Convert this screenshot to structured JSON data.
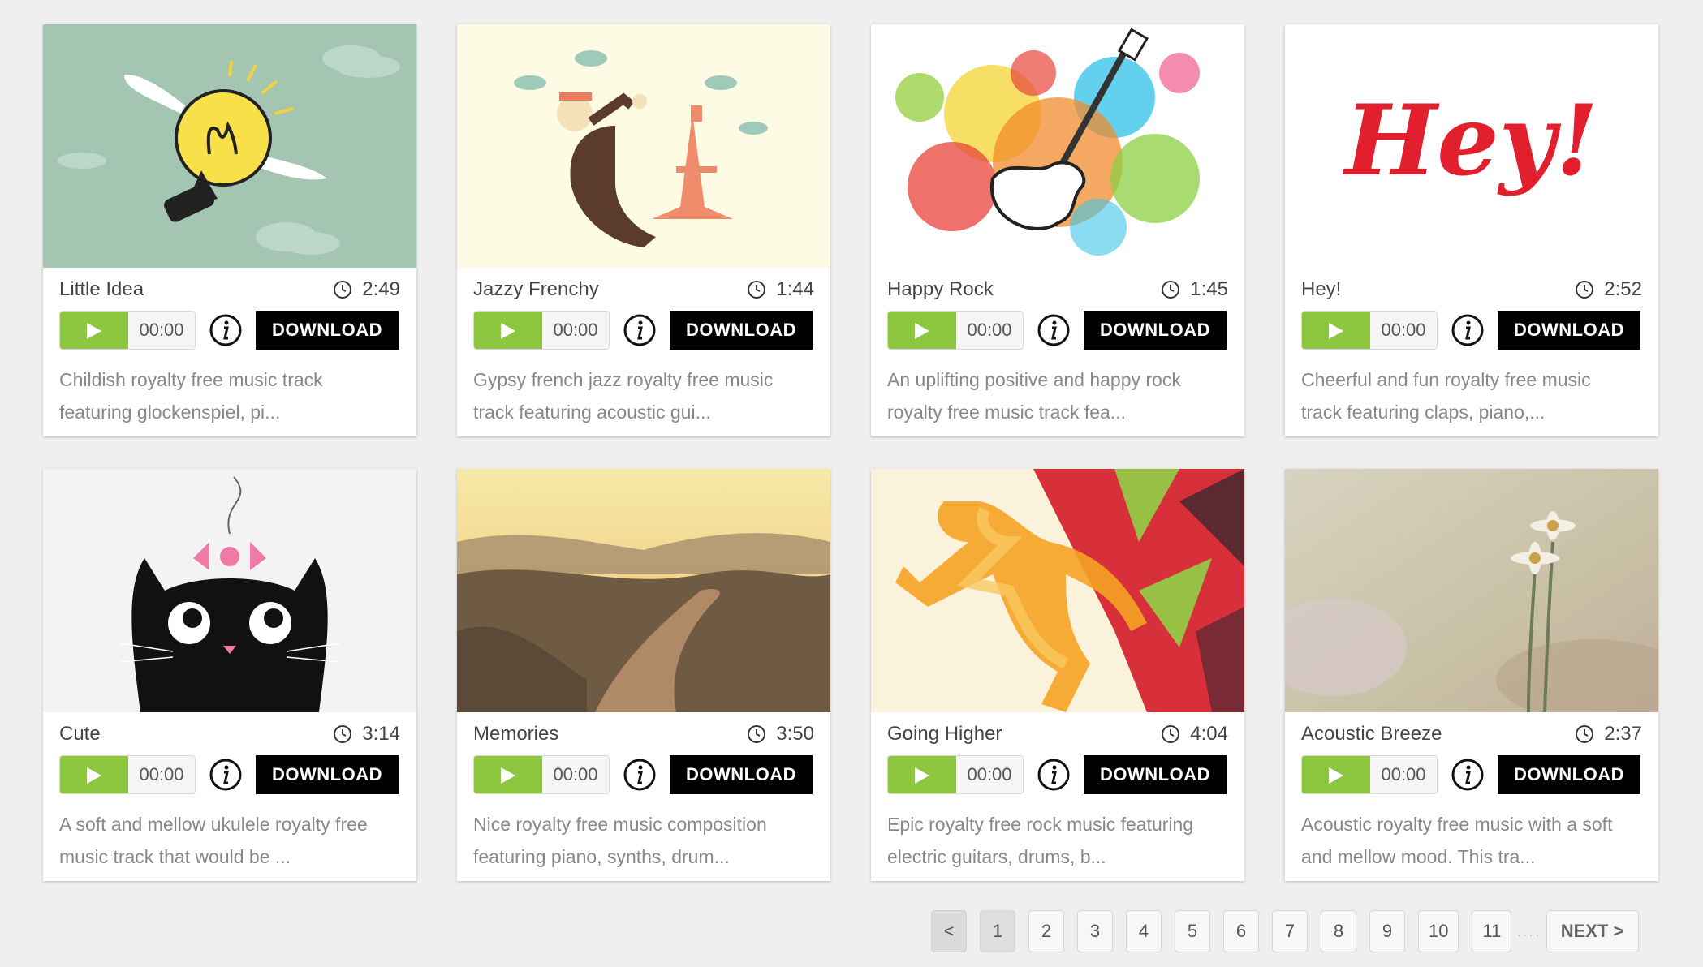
{
  "tracks": [
    {
      "title": "Little Idea",
      "duration": "2:49",
      "time": "00:00",
      "download": "DOWNLOAD",
      "desc1": "Childish royalty free music track",
      "desc2": "featuring glockenspiel, pi...",
      "art": "lightbulb-with-wings"
    },
    {
      "title": "Jazzy Frenchy",
      "duration": "1:44",
      "time": "00:00",
      "download": "DOWNLOAD",
      "desc1": "Gypsy french jazz royalty free music",
      "desc2": "track featuring acoustic gui...",
      "art": "man-and-eiffel-tower"
    },
    {
      "title": "Happy Rock",
      "duration": "1:45",
      "time": "00:00",
      "download": "DOWNLOAD",
      "desc1": "An uplifting positive and happy rock",
      "desc2": "royalty free music track fea...",
      "art": "guitar-paint-splash"
    },
    {
      "title": "Hey!",
      "duration": "2:52",
      "time": "00:00",
      "download": "DOWNLOAD",
      "desc1": "Cheerful and fun royalty free music",
      "desc2": "track featuring claps, piano,...",
      "art": "hey-lettering",
      "art_text": "Hey!"
    },
    {
      "title": "Cute",
      "duration": "3:14",
      "time": "00:00",
      "download": "DOWNLOAD",
      "desc1": "A soft and mellow ukulele royalty free",
      "desc2": "music track that would be ...",
      "art": "black-cat-with-bow"
    },
    {
      "title": "Memories",
      "duration": "3:50",
      "time": "00:00",
      "download": "DOWNLOAD",
      "desc1": "Nice royalty free music composition",
      "desc2": "featuring piano, synths, drum...",
      "art": "country-road-sunset"
    },
    {
      "title": "Going Higher",
      "duration": "4:04",
      "time": "00:00",
      "download": "DOWNLOAD",
      "desc1": "Epic royalty free rock music featuring",
      "desc2": "electric guitars, drums, b...",
      "art": "runner-low-poly"
    },
    {
      "title": "Acoustic Breeze",
      "duration": "2:37",
      "time": "00:00",
      "download": "DOWNLOAD",
      "desc1": "Acoustic royalty free music with a soft",
      "desc2": "and mellow mood. This tra...",
      "art": "daisy-flowers"
    }
  ],
  "pagination": {
    "prev": "<",
    "pages": [
      "1",
      "2",
      "3",
      "4",
      "5",
      "6",
      "7",
      "8",
      "9",
      "10",
      "11"
    ],
    "current": "1",
    "ellipsis": "....",
    "next": "NEXT >"
  },
  "colors": {
    "play": "#8dc63f",
    "download": "#000000",
    "background": "#efefef"
  }
}
